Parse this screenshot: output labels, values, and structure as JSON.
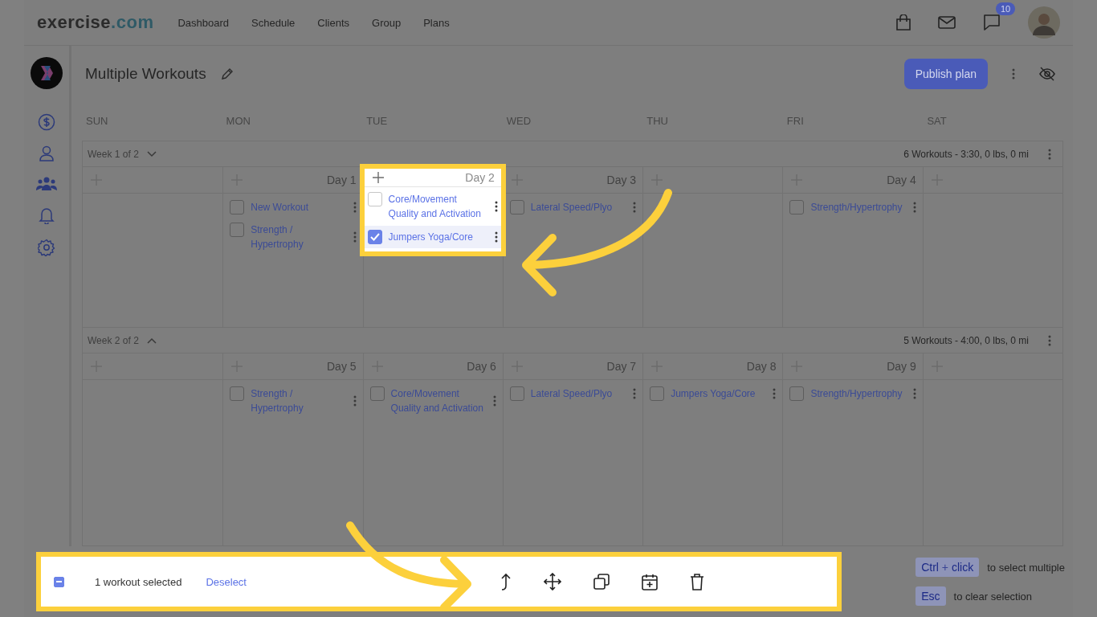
{
  "topbar": {
    "logo": {
      "main": "exercise",
      "accent": ".com"
    },
    "nav": [
      "Dashboard",
      "Schedule",
      "Clients",
      "Group",
      "Plans"
    ],
    "message_badge": "10"
  },
  "plan": {
    "title": "Multiple Workouts",
    "publish_button": "Publish plan"
  },
  "weekdays": [
    "SUN",
    "MON",
    "TUE",
    "WED",
    "THU",
    "FRI",
    "SAT"
  ],
  "weeks": [
    {
      "label": "Week 1 of 2",
      "expanded": false,
      "summary": "6 Workouts - 3:30, 0 lbs, 0 mi",
      "days": [
        {
          "kind": "blank"
        },
        {
          "kind": "day",
          "day_label": "Day 1",
          "workouts": [
            {
              "name": "New Workout",
              "checked": false
            },
            {
              "name": "Strength / Hypertrophy",
              "checked": false
            }
          ]
        },
        {
          "kind": "day",
          "day_label": "Day 2",
          "highlighted": true,
          "workouts": [
            {
              "name": "Core/Movement Quality and Activation",
              "checked": false
            },
            {
              "name": "Jumpers Yoga/Core",
              "checked": true
            }
          ]
        },
        {
          "kind": "day",
          "day_label": "Day 3",
          "workouts": [
            {
              "name": "Lateral Speed/Plyo",
              "checked": false
            }
          ]
        },
        {
          "kind": "blank"
        },
        {
          "kind": "day",
          "day_label": "Day 4",
          "workouts": [
            {
              "name": "Strength/Hypertrophy",
              "checked": false
            }
          ]
        },
        {
          "kind": "blank"
        }
      ]
    },
    {
      "label": "Week 2 of 2",
      "expanded": true,
      "summary": "5 Workouts - 4:00, 0 lbs, 0 mi",
      "days": [
        {
          "kind": "blank"
        },
        {
          "kind": "day",
          "day_label": "Day 5",
          "workouts": [
            {
              "name": "Strength / Hypertrophy",
              "checked": false
            }
          ]
        },
        {
          "kind": "day",
          "day_label": "Day 6",
          "workouts": [
            {
              "name": "Core/Movement Quality and Activation",
              "checked": false
            }
          ]
        },
        {
          "kind": "day",
          "day_label": "Day 7",
          "workouts": [
            {
              "name": "Lateral Speed/Plyo",
              "checked": false
            }
          ]
        },
        {
          "kind": "day",
          "day_label": "Day 8",
          "workouts": [
            {
              "name": "Jumpers Yoga/Core",
              "checked": false
            }
          ]
        },
        {
          "kind": "day",
          "day_label": "Day 9",
          "workouts": [
            {
              "name": "Strength/Hypertrophy",
              "checked": false
            }
          ]
        },
        {
          "kind": "blank"
        }
      ]
    }
  ],
  "selection_bar": {
    "partially_checked": true,
    "count_text": "1 workout selected",
    "deselect": "Deselect"
  },
  "hints": [
    {
      "keys": [
        "Ctrl",
        "+",
        "click"
      ],
      "text": "to select multiple"
    },
    {
      "keys": [
        "Esc"
      ],
      "text": "to clear selection"
    }
  ]
}
